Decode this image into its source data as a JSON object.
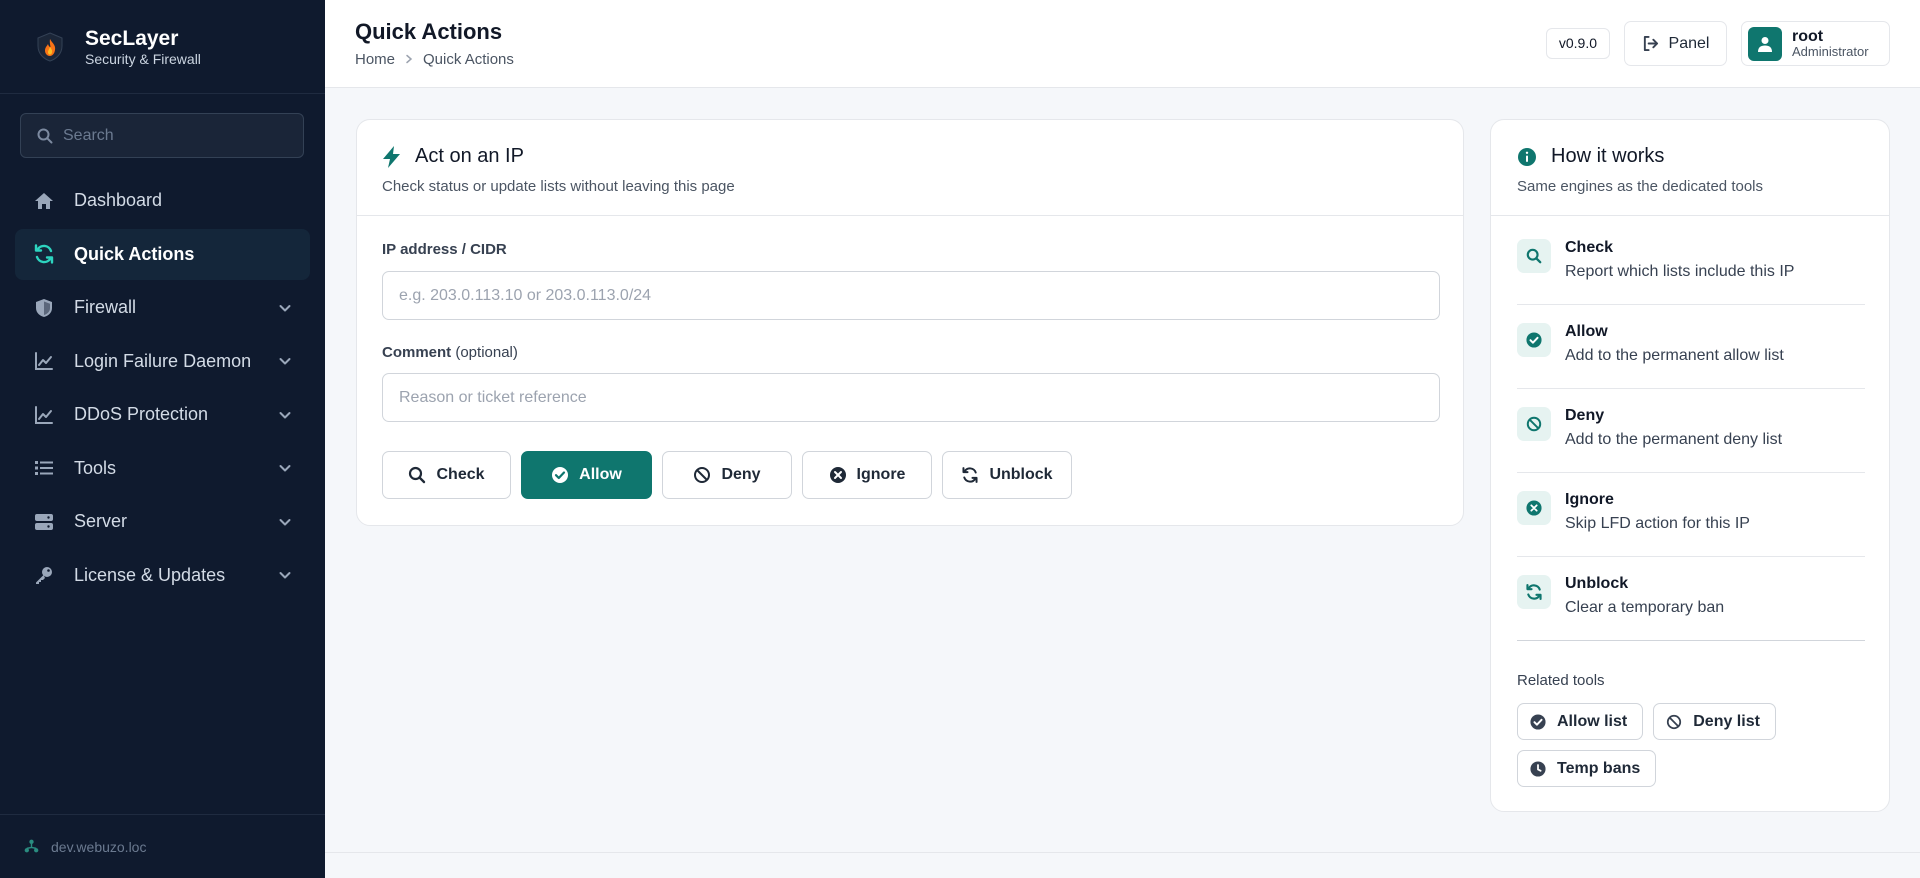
{
  "brand": {
    "name": "SecLayer",
    "subtitle": "Security & Firewall"
  },
  "search": {
    "placeholder": "Search"
  },
  "nav": [
    {
      "label": "Dashboard",
      "icon": "home-icon",
      "active": false,
      "expandable": false
    },
    {
      "label": "Quick Actions",
      "icon": "refresh-icon",
      "active": true,
      "expandable": false
    },
    {
      "label": "Firewall",
      "icon": "shield-icon",
      "active": false,
      "expandable": true
    },
    {
      "label": "Login Failure Daemon",
      "icon": "chart-line-icon",
      "active": false,
      "expandable": true
    },
    {
      "label": "DDoS Protection",
      "icon": "chart-line-icon",
      "active": false,
      "expandable": true
    },
    {
      "label": "Tools",
      "icon": "list-icon",
      "active": false,
      "expandable": true
    },
    {
      "label": "Server",
      "icon": "server-icon",
      "active": false,
      "expandable": true
    },
    {
      "label": "License & Updates",
      "icon": "key-icon",
      "active": false,
      "expandable": true
    }
  ],
  "footer": {
    "host": "dev.webuzo.loc"
  },
  "header": {
    "title": "Quick Actions",
    "breadcrumb": [
      "Home",
      "Quick Actions"
    ],
    "version": "v0.9.0",
    "panel_label": "Panel",
    "user": {
      "name": "root",
      "role": "Administrator"
    }
  },
  "main": {
    "title": "Act on an IP",
    "subtitle": "Check status or update lists without leaving this page",
    "ip_label": "IP address / CIDR",
    "ip_value": "",
    "ip_placeholder": "e.g. 203.0.113.10 or 203.0.113.0/24",
    "comment_label": "Comment",
    "comment_optional": "(optional)",
    "comment_value": "",
    "comment_placeholder": "Reason or ticket reference",
    "actions": [
      {
        "label": "Check",
        "icon": "search-icon",
        "primary": false
      },
      {
        "label": "Allow",
        "icon": "check-circle-icon",
        "primary": true
      },
      {
        "label": "Deny",
        "icon": "ban-icon",
        "primary": false
      },
      {
        "label": "Ignore",
        "icon": "x-circle-icon",
        "primary": false
      },
      {
        "label": "Unblock",
        "icon": "refresh-icon",
        "primary": false
      }
    ]
  },
  "how": {
    "title": "How it works",
    "subtitle": "Same engines as the dedicated tools",
    "items": [
      {
        "title": "Check",
        "desc": "Report which lists include this IP",
        "icon": "search-icon"
      },
      {
        "title": "Allow",
        "desc": "Add to the permanent allow list",
        "icon": "check-circle-icon"
      },
      {
        "title": "Deny",
        "desc": "Add to the permanent deny list",
        "icon": "ban-icon"
      },
      {
        "title": "Ignore",
        "desc": "Skip LFD action for this IP",
        "icon": "x-circle-icon"
      },
      {
        "title": "Unblock",
        "desc": "Clear a temporary ban",
        "icon": "refresh-icon"
      }
    ],
    "related_label": "Related tools",
    "related": [
      {
        "label": "Allow list",
        "icon": "check-circle-icon"
      },
      {
        "label": "Deny list",
        "icon": "ban-icon"
      },
      {
        "label": "Temp bans",
        "icon": "clock-icon"
      }
    ]
  },
  "colors": {
    "accent": "#0f766e",
    "sidebar_bg": "#0f1a2e",
    "accent_soft": "#e6f3f1"
  }
}
